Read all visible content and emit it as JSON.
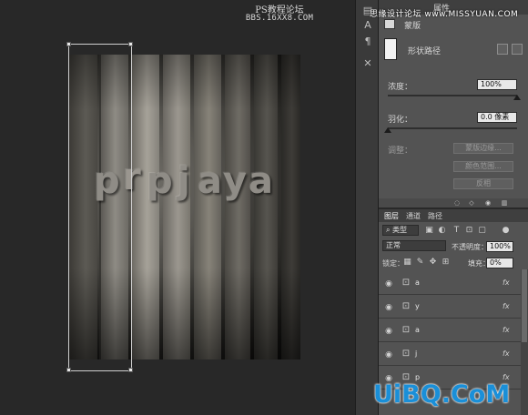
{
  "canvas": {
    "forum_title": "PS教程论坛",
    "forum_url": "BBS.16XX8.COM",
    "letters": [
      "p",
      "r",
      "p",
      "j",
      "a",
      "y",
      "a"
    ]
  },
  "watermark": {
    "top_text": "思缘设计论坛 www.MISSYUAN.COM",
    "logo_text": "UiBQ.CoM"
  },
  "properties": {
    "tab_label": "属性",
    "mask_label": "蒙版",
    "path_label": "形状路径",
    "density_label": "浓度：",
    "density_value": "100%",
    "density_fraction": 1.0,
    "feather_label": "羽化：",
    "feather_value": "0.0 像素",
    "feather_fraction": 0.0,
    "adjust_label": "调整：",
    "buttons": [
      "蒙版边缘...",
      "颜色范围...",
      "反相"
    ]
  },
  "layers": {
    "tabs": [
      "图层",
      "通道",
      "路径"
    ],
    "filter_label": "类型",
    "blend_mode": "正常",
    "opacity_label": "不透明度：",
    "opacity_value": "100%",
    "lock_label": "锁定：",
    "fill_label": "填充：",
    "fill_value": "0%",
    "rows": [
      {
        "name": "a",
        "fx": "fx"
      },
      {
        "name": "y",
        "fx": "fx"
      },
      {
        "name": "a",
        "fx": "fx"
      },
      {
        "name": "j",
        "fx": "fx"
      },
      {
        "name": "p",
        "fx": "fx"
      }
    ]
  },
  "colors": {
    "panel_bg": "#535353",
    "canvas_bg": "#282828",
    "logo_blue": "#1a8fd8"
  }
}
